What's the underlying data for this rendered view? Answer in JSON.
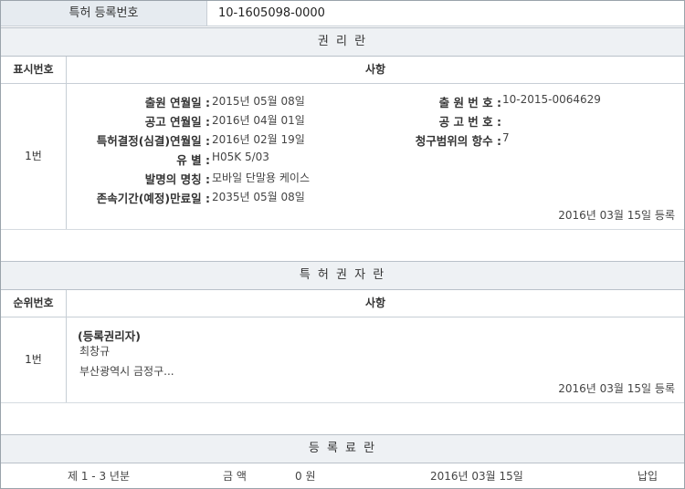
{
  "registration": {
    "label": "특허 등록번호",
    "number": "10-1605098-0000"
  },
  "rights_section": {
    "title": "권 리 란",
    "col_num": "표시번호",
    "col_matter": "사항",
    "row_num": "1번",
    "fields": {
      "application_date_label": "출원 연월일 :",
      "application_date": "2015년 05월 08일",
      "application_no_label": "출 원 번 호 :",
      "application_no": "10-2015-0064629",
      "publication_date_label": "공고 연월일 :",
      "publication_date": "2016년 04월 01일",
      "publication_no_label": "공 고 번 호 :",
      "publication_no": "",
      "decision_date_label": "특허결정(심결)연월일 :",
      "decision_date": "2016년 02월 19일",
      "claims_label": "청구범위의 항수 :",
      "claims": "7",
      "class_label": "유 별 :",
      "class": "H05K 5/03",
      "invention_label": "발명의 명칭 :",
      "invention": "모바일 단말용 케이스",
      "expiry_label": "존속기간(예정)만료일 :",
      "expiry": "2035년 05월 08일"
    },
    "registered": "2016년 03월 15일 등록"
  },
  "patentee_section": {
    "title": "특 허 권 자 란",
    "col_num": "순위번호",
    "col_matter": "사항",
    "row_num": "1번",
    "type": "(등록권리자)",
    "name": "최창규",
    "address": "부산광역시 금정구...",
    "registered": "2016년 03월 15일 등록"
  },
  "fee_section": {
    "title": "등 록 료 란",
    "period": "제 1 - 3 년분",
    "amount_label": "금 액",
    "amount": "0 원",
    "date": "2016년 03월 15일",
    "status": "납입"
  }
}
